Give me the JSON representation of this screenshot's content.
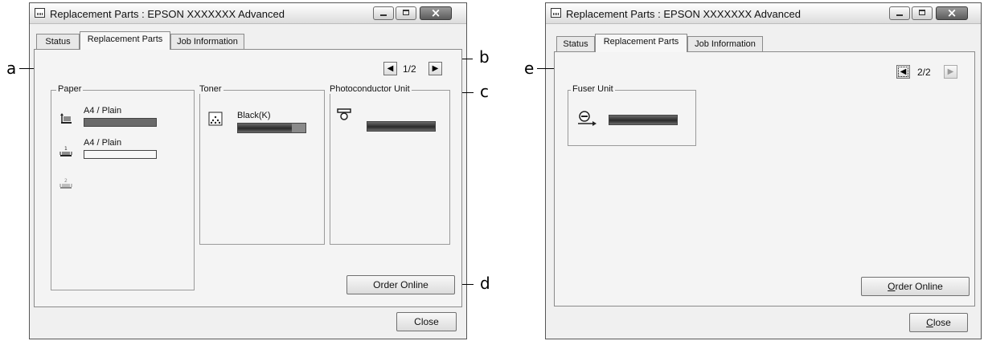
{
  "window1": {
    "title": "Replacement Parts : EPSON XXXXXXX  Advanced",
    "tabs": [
      {
        "label": "Status",
        "active": false
      },
      {
        "label": "Replacement Parts",
        "active": true
      },
      {
        "label": "Job Information",
        "active": false
      }
    ],
    "page_indicator": "1/2",
    "paper": {
      "title": "Paper",
      "trays": [
        {
          "label": "A4 / Plain",
          "icon": "mp-tray-icon",
          "level": 1.0
        },
        {
          "label": "A4 / Plain",
          "icon": "tray-1-icon",
          "level": 0.0
        },
        {
          "label": "",
          "icon": "tray-2-icon"
        }
      ]
    },
    "toner": {
      "title": "Toner",
      "label": "Black(K)",
      "level": 0.75
    },
    "photoconductor": {
      "title": "Photoconductor Unit",
      "level": 1.0
    },
    "order_online_label": "Order Online",
    "close_label": "Close"
  },
  "window2": {
    "title": "Replacement Parts : EPSON XXXXXXX  Advanced",
    "tabs": [
      {
        "label": "Status",
        "active": false
      },
      {
        "label": "Replacement Parts",
        "active": true
      },
      {
        "label": "Job Information",
        "active": false
      }
    ],
    "page_indicator": "2/2",
    "fuser": {
      "title": "Fuser Unit",
      "level": 1.0
    },
    "order_online_label": "Order Online",
    "close_label": "Close"
  },
  "callouts": {
    "a": "a",
    "b": "b",
    "c": "c",
    "d": "d",
    "e": "e"
  }
}
